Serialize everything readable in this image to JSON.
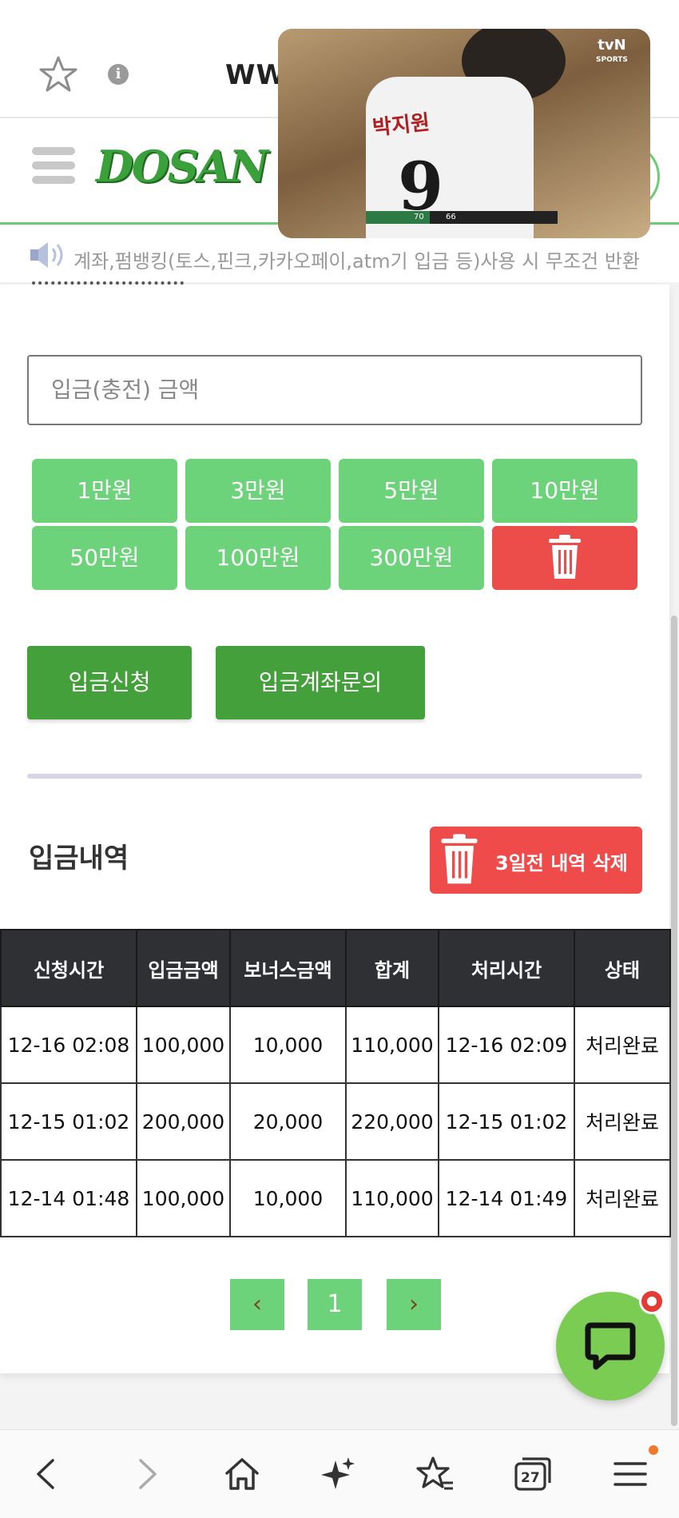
{
  "browser": {
    "url_visible": "WW"
  },
  "site": {
    "logo_text": "DOSAN",
    "notice_text": "계좌,펌뱅킹(토스,핀크,카카오페이,atm기 입금 등)사용 시 무조건 반환"
  },
  "deposit_form": {
    "amount_placeholder": "입금(충전) 금액",
    "amount_chips": [
      "1만원",
      "3만원",
      "5만원",
      "10만원",
      "50만원",
      "100만원",
      "300만원"
    ],
    "submit_label": "입금신청",
    "inquiry_label": "입금계좌문의"
  },
  "history": {
    "title": "입금내역",
    "delete_label": "3일전 내역 삭제",
    "columns": [
      "신청시간",
      "입금금액",
      "보너스금액",
      "합계",
      "처리시간",
      "상태"
    ],
    "rows": [
      [
        "12-16 02:08",
        "100,000",
        "10,000",
        "110,000",
        "12-16 02:09",
        "처리완료"
      ],
      [
        "12-15 01:02",
        "200,000",
        "20,000",
        "220,000",
        "12-15 01:02",
        "처리완료"
      ],
      [
        "12-14 01:48",
        "100,000",
        "10,000",
        "110,000",
        "12-14 01:49",
        "처리완료"
      ]
    ]
  },
  "pagination": {
    "prev": "‹",
    "current": "1",
    "next": "›"
  },
  "video_overlay": {
    "player_name": "박지원",
    "player_number": "9",
    "channel": "tvN",
    "channel_sub": "SPORTS",
    "score_home": "70",
    "score_away": "66"
  },
  "bottom_nav": {
    "tabs_count": "27"
  },
  "colors": {
    "accent_green": "#6dd37a",
    "dark_green": "#43a03b",
    "danger_red": "#ec4c4a",
    "table_header": "#2f3034"
  }
}
